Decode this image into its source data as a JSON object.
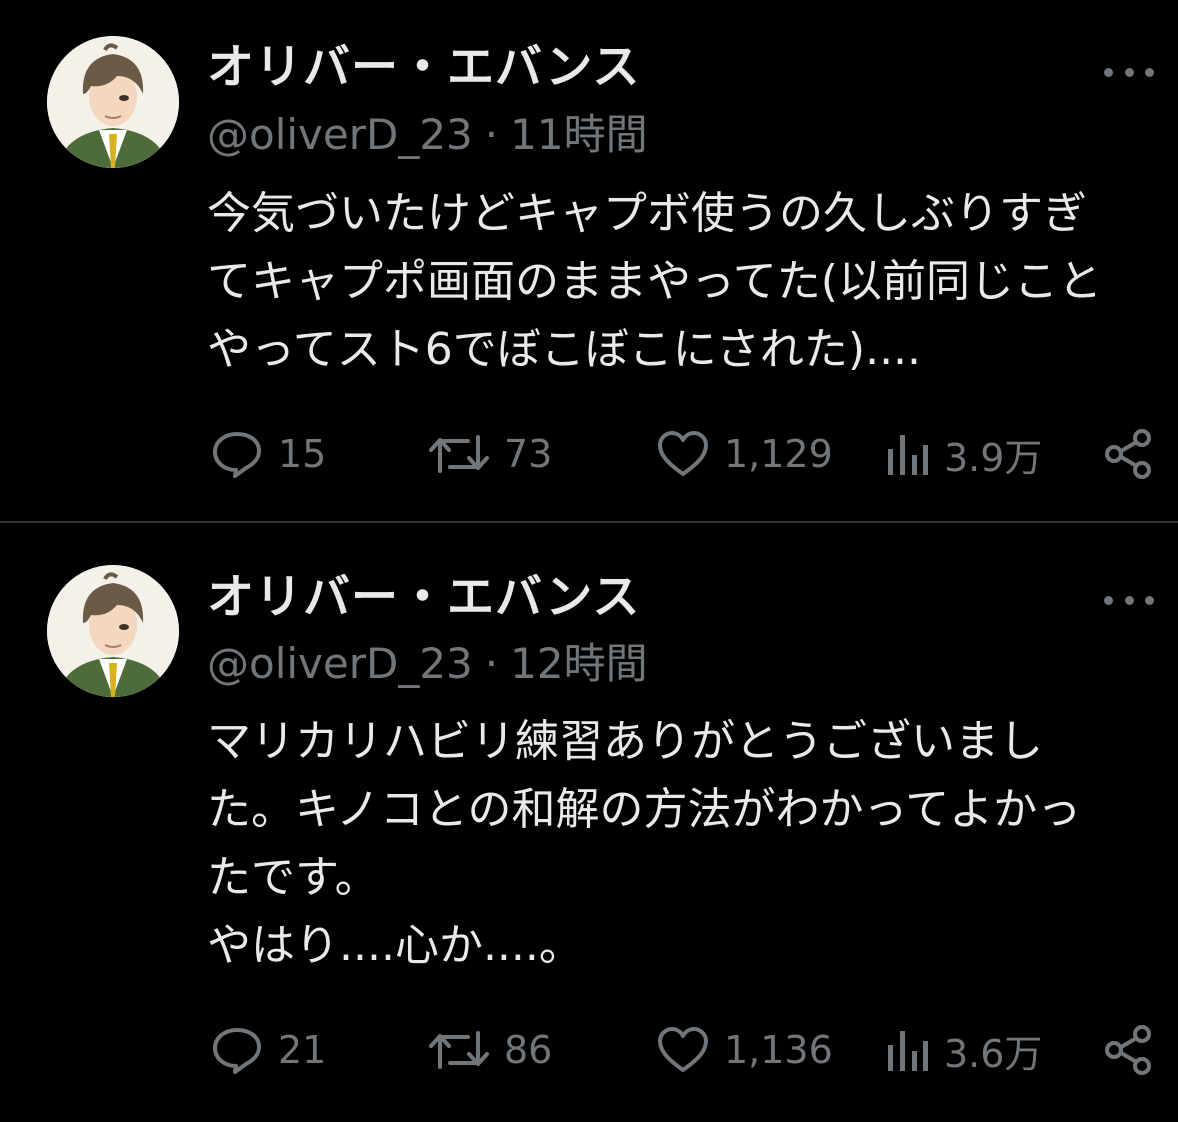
{
  "tweets": [
    {
      "display_name": "オリバー・エバンス",
      "handle": "@oliverD_23",
      "separator": "·",
      "time": "11時間",
      "lines": [
        "今気づいたけどキャプボ使うの久しぶりすぎ",
        "てキャプポ画面のままやってた(以前同じこと",
        "やってスト6でぼこぼこにされた)...."
      ],
      "replies": "15",
      "retweets": "73",
      "likes": "1,129",
      "views": "3.9万"
    },
    {
      "display_name": "オリバー・エバンス",
      "handle": "@oliverD_23",
      "separator": "·",
      "time": "12時間",
      "lines": [
        "マリカリハビリ練習ありがとうございまし",
        "た。キノコとの和解の方法がわかってよかっ",
        "たです。",
        "やはり....心か....。"
      ],
      "replies": "21",
      "retweets": "86",
      "likes": "1,136",
      "views": "3.6万"
    }
  ],
  "icons": {
    "more": "more-horizontal-icon",
    "reply": "reply-bubble-icon",
    "retweet": "retweet-icon",
    "like": "heart-icon",
    "views": "views-bar-chart-icon",
    "share": "share-icon"
  },
  "colors": {
    "background": "#000000",
    "text_primary": "#e7e9ea",
    "text_secondary": "#71767b",
    "divider": "#2f3336"
  }
}
